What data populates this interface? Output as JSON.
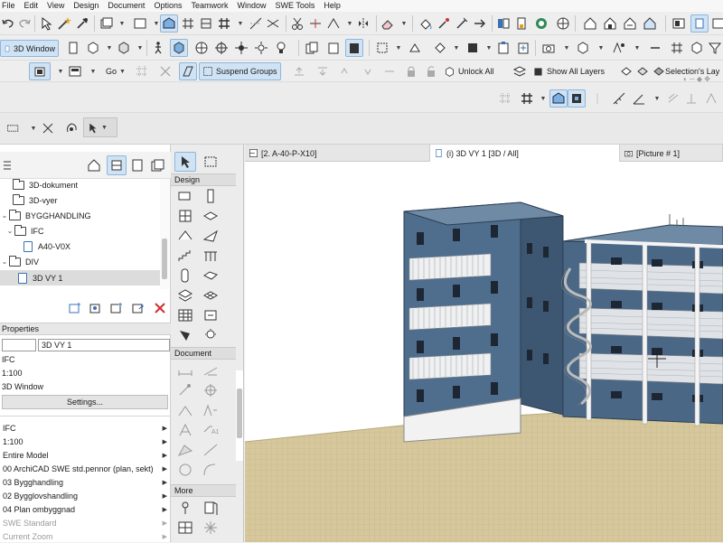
{
  "menu": [
    "File",
    "Edit",
    "View",
    "Design",
    "Document",
    "Options",
    "Teamwork",
    "Window",
    "SWE Tools",
    "Help"
  ],
  "toolbar2": {
    "view_button": "3D Window"
  },
  "toolbar3": {
    "go_label": "Go",
    "suspend_groups": "Suspend Groups",
    "unlock_all": "Unlock All",
    "show_all_layers": "Show All Layers",
    "selections_layer": "Selection's Lay"
  },
  "navigator": {
    "items": [
      {
        "label": "3D-dokument",
        "type": "folder"
      },
      {
        "label": "3D-vyer",
        "type": "folder"
      },
      {
        "label": "BYGGHANDLING",
        "type": "folder",
        "toggle": "⌄"
      },
      {
        "label": "IFC",
        "type": "folder",
        "toggle": "⌄"
      },
      {
        "label": "A40-V0X",
        "type": "doc"
      },
      {
        "label": "DIV",
        "type": "folder",
        "toggle": "⌄"
      },
      {
        "label": "3D VY 1",
        "type": "doc",
        "selected": true
      }
    ]
  },
  "properties": {
    "header": "Properties",
    "name_value": "3D VY 1",
    "line1": "IFC",
    "line2": "1:100",
    "line3": "3D Window",
    "settings_button": "Settings...",
    "list": [
      {
        "label": "IFC",
        "dim": false
      },
      {
        "label": "1:100",
        "dim": false
      },
      {
        "label": "Entire Model",
        "dim": false
      },
      {
        "label": "00 ArchiCAD SWE std.pennor (plan, sekt)",
        "dim": false
      },
      {
        "label": "03 Bygghandling",
        "dim": false
      },
      {
        "label": "02 Bygglovshandling",
        "dim": false
      },
      {
        "label": "04 Plan ombyggnad",
        "dim": false
      },
      {
        "label": "SWE Standard",
        "dim": true
      },
      {
        "label": "Current Zoom",
        "dim": true
      }
    ]
  },
  "toolbox": {
    "design_label": "Design",
    "document_label": "Document",
    "more_label": "More"
  },
  "tabs": [
    {
      "label": "[2. A-40-P-X10]",
      "active": false
    },
    {
      "label": "(i) 3D VY 1 [3D / All]",
      "active": true
    },
    {
      "label": "[Picture # 1]",
      "active": false
    }
  ],
  "colors": {
    "accent": "#3a72b5",
    "facade_blue": "#4f6e8e",
    "ground": "#d6c89c"
  }
}
